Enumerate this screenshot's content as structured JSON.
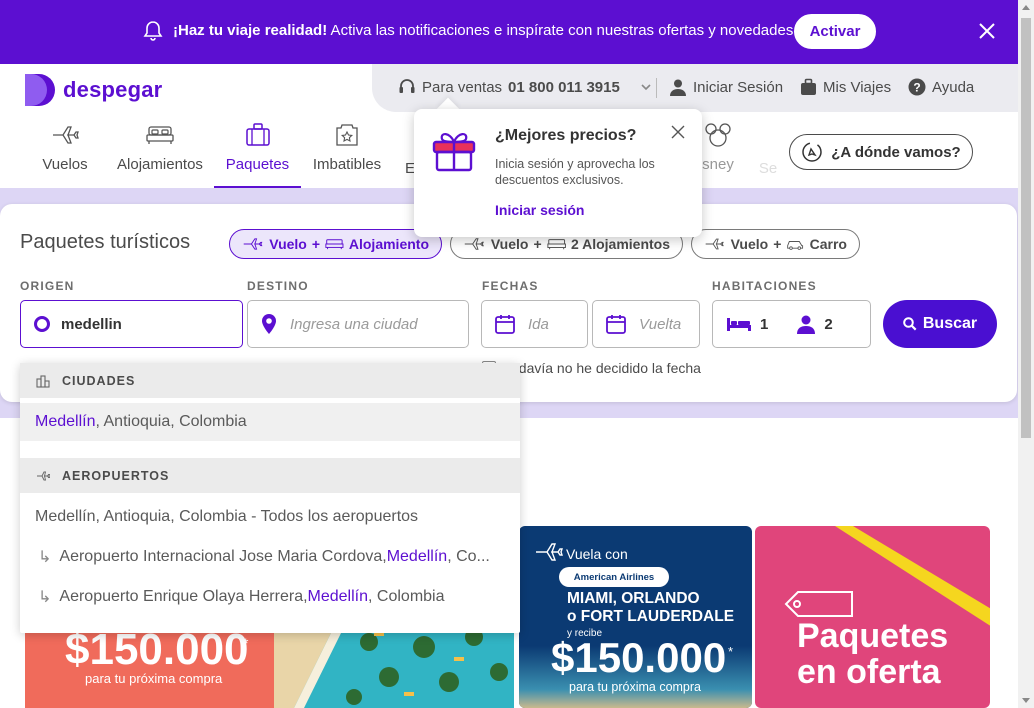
{
  "banner": {
    "bold_text": "¡Haz tu viaje realidad!",
    "text": " Activa las notificaciones e inspírate con nuestras ofertas y novedades.",
    "activate_label": "Activar"
  },
  "brand": {
    "name": "despegar",
    "accent": "#5c0fd1"
  },
  "top_utils": {
    "sales_label": "Para ventas",
    "sales_phone": "01 800 011 3915",
    "login_label": "Iniciar Sesión",
    "trips_label": "Mis Viajes",
    "help_label": "Ayuda"
  },
  "nav": {
    "tabs": [
      {
        "label": "Vuelos",
        "icon": "plane-icon"
      },
      {
        "label": "Alojamientos",
        "icon": "bed-icon"
      },
      {
        "label": "Paquetes",
        "icon": "suitcase-icon",
        "active": true
      },
      {
        "label": "Imbatibles",
        "icon": "badge-icon"
      },
      {
        "label": "E",
        "icon": "none"
      },
      {
        "label": "sney",
        "icon": "mickey-icon"
      },
      {
        "label": "Se",
        "icon": "none"
      }
    ],
    "where_label": "¿A dónde vamos?"
  },
  "popup": {
    "title": "¿Mejores precios?",
    "description": "Inicia sesión y aprovecha los descuentos exclusivos.",
    "link": "Iniciar sesión"
  },
  "search": {
    "title": "Paquetes turísticos",
    "product_pills": [
      {
        "a": "Vuelo",
        "b": "Alojamiento",
        "active": true
      },
      {
        "a": "Vuelo",
        "b": "2 Alojamientos",
        "active": false
      },
      {
        "a": "Vuelo",
        "b": "Carro",
        "active": false
      }
    ],
    "labels": {
      "origin": "ORIGEN",
      "destination": "DESTINO",
      "dates": "FECHAS",
      "rooms": "HABITACIONES"
    },
    "origin_value": "medellin",
    "destination_placeholder": "Ingresa una ciudad",
    "depart_placeholder": "Ida",
    "return_placeholder": "Vuelta",
    "rooms_count": "1",
    "guests_count": "2",
    "search_label": "Buscar",
    "undecided_label": "Todavía no he decidido la fecha"
  },
  "dropdown": {
    "cities_header": "CIUDADES",
    "airports_header": "AEROPUERTOS",
    "city_result": {
      "match": "Medellín",
      "rest": ", Antioquia, Colombia"
    },
    "airport_all": "Medellín, Antioquia, Colombia - Todos los aeropuertos",
    "airports": [
      {
        "pre": "Aeropuerto Internacional Jose Maria Cordova, ",
        "match": "Medellín",
        "post": ", Co..."
      },
      {
        "pre": "Aeropuerto Enrique Olaya Herrera, ",
        "match": "Medellín",
        "post": ", Colombia"
      }
    ]
  },
  "promos": {
    "red": {
      "amount": "$150.000",
      "star": "*",
      "caption": "para tu próxima compra"
    },
    "aa": {
      "fly_with": "Vuela con",
      "airline": "American Airlines",
      "cities_1": "MIAMI, ORLANDO",
      "cities_2": "o FORT LAUDERDALE",
      "receive": "y recibe",
      "amount": "$150.000",
      "star": "*",
      "caption": "para tu próxima compra"
    },
    "pink": {
      "line1": "Paquetes",
      "line2": "en oferta"
    }
  }
}
